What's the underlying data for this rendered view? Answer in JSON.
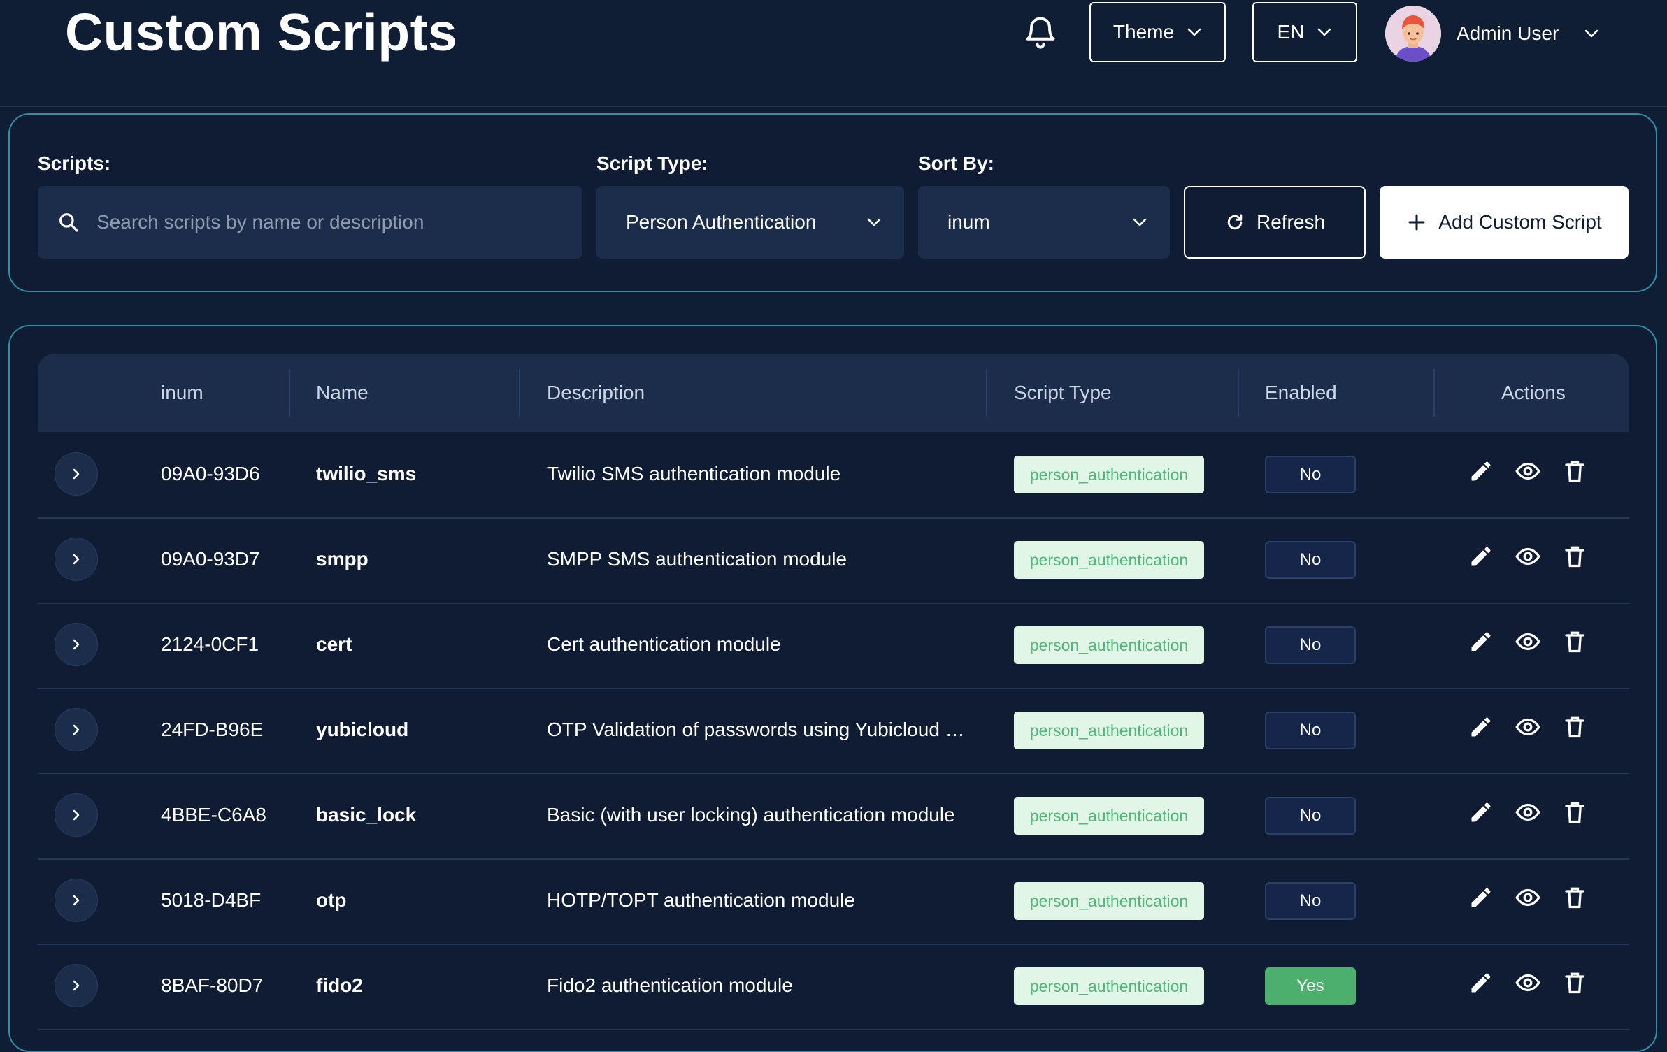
{
  "header": {
    "title": "Custom Scripts",
    "theme_label": "Theme",
    "lang_label": "EN",
    "user_name": "Admin User"
  },
  "filters": {
    "scripts_label": "Scripts:",
    "search_placeholder": "Search scripts by name or description",
    "script_type_label": "Script Type:",
    "script_type_value": "Person Authentication",
    "sort_label": "Sort By:",
    "sort_value": "inum",
    "refresh_label": "Refresh",
    "add_label": "Add Custom Script"
  },
  "table": {
    "columns": [
      "inum",
      "Name",
      "Description",
      "Script Type",
      "Enabled",
      "Actions"
    ],
    "rows": [
      {
        "inum": "09A0-93D6",
        "name": "twilio_sms",
        "description": "Twilio SMS authentication module",
        "type": "person_authentication",
        "enabled": "No"
      },
      {
        "inum": "09A0-93D7",
        "name": "smpp",
        "description": "SMPP SMS authentication module",
        "type": "person_authentication",
        "enabled": "No"
      },
      {
        "inum": "2124-0CF1",
        "name": "cert",
        "description": "Cert authentication module",
        "type": "person_authentication",
        "enabled": "No"
      },
      {
        "inum": "24FD-B96E",
        "name": "yubicloud",
        "description": "OTP Validation of passwords using Yubicloud …",
        "type": "person_authentication",
        "enabled": "No"
      },
      {
        "inum": "4BBE-C6A8",
        "name": "basic_lock",
        "description": "Basic (with user locking) authentication module",
        "type": "person_authentication",
        "enabled": "No"
      },
      {
        "inum": "5018-D4BF",
        "name": "otp",
        "description": "HOTP/TOPT authentication module",
        "type": "person_authentication",
        "enabled": "No"
      },
      {
        "inum": "8BAF-80D7",
        "name": "fido2",
        "description": "Fido2 authentication module",
        "type": "person_authentication",
        "enabled": "Yes"
      }
    ]
  },
  "colors": {
    "background": "#0f1d35",
    "panel_border": "#2f8fa3",
    "badge_type_bg": "#e2f6e8",
    "badge_type_text": "#4fb87a",
    "enabled_yes": "#4caf6e"
  },
  "icons": {
    "bell": "bell-icon",
    "search": "search-icon",
    "chevron": "chevron-down-icon",
    "refresh": "refresh-icon",
    "plus": "plus-icon",
    "expand": "chevron-right-icon",
    "edit": "pencil-icon",
    "view": "eye-icon",
    "delete": "trash-icon"
  }
}
